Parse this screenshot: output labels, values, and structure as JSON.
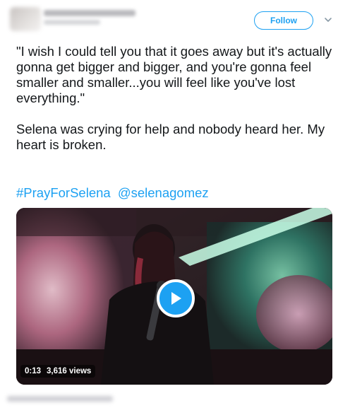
{
  "header": {
    "follow_label": "Follow",
    "follow_color": "#1da1f2"
  },
  "tweet": {
    "quote": "\"I wish I could tell you that it goes away but it's actually gonna get bigger and bigger, and you're gonna feel smaller and smaller...you will feel like you've lost everything.\"",
    "body": "Selena was crying for help and nobody heard her. My heart is broken.",
    "hashtag": "#PrayForSelena",
    "mention": "@selenagomez",
    "link_color": "#1da1f2"
  },
  "video": {
    "duration": "0:13",
    "views": "3,616 views",
    "play_icon": "play-icon"
  },
  "icons": {
    "caret": "chevron-down-icon",
    "play": "play-icon"
  }
}
